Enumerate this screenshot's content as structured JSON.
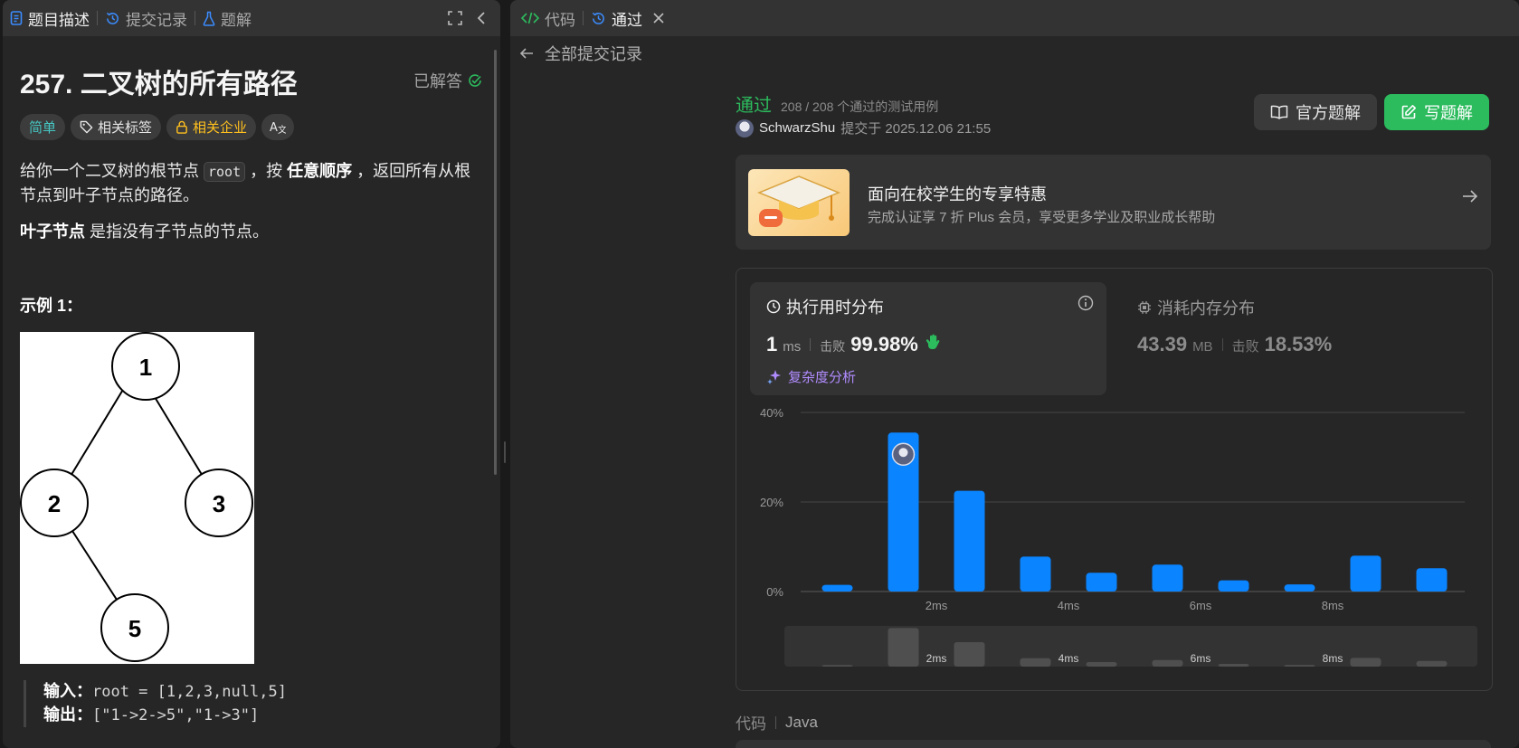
{
  "left_tabs": [
    {
      "label": "题目描述",
      "icon": "document-icon"
    },
    {
      "label": "提交记录",
      "icon": "history-icon"
    },
    {
      "label": "题解",
      "icon": "flask-icon"
    }
  ],
  "problem": {
    "title": "257. 二叉树的所有路径",
    "solved_label": "已解答",
    "tags": {
      "difficulty": "简单",
      "related_tags": "相关标签",
      "related_companies": "相关企业"
    },
    "desc_p1_a": "给你一个二叉树的根节点 ",
    "desc_p1_code": "root",
    "desc_p1_b": " ，按 ",
    "desc_p1_bold": "任意顺序",
    "desc_p1_c": " ，返回所有从根节点到叶子节点的路径。",
    "desc_p2_bold": "叶子节点",
    "desc_p2_rest": " 是指没有子节点的节点。",
    "example_title": "示例 1：",
    "tree_nodes": [
      "1",
      "2",
      "3",
      "5"
    ],
    "input_label": "输入：",
    "input_value": "root = [1,2,3,null,5]",
    "output_label": "输出：",
    "output_value": "[\"1->2->5\",\"1->3\"]"
  },
  "right_tabs": [
    {
      "label": "代码",
      "icon": "code-icon"
    },
    {
      "label": "通过",
      "icon": "history-icon"
    }
  ],
  "back_label": "全部提交记录",
  "submission": {
    "status": "通过",
    "cases": "208 / 208 个通过的测试用例",
    "user": "SchwarzShu",
    "submitted_at": "提交于 2025.12.06 21:55",
    "official_button": "官方题解",
    "write_button": "写题解"
  },
  "promo": {
    "title": "面向在校学生的专享特惠",
    "subtitle": "完成认证享 7 折 Plus 会员，享受更多学业及职业成长帮助"
  },
  "runtime": {
    "title": "执行用时分布",
    "value": "1",
    "unit": "ms",
    "beat_label": "击败",
    "beat_pct": "99.98%",
    "complexity_label": "复杂度分析"
  },
  "memory": {
    "title": "消耗内存分布",
    "value": "43.39",
    "unit": "MB",
    "beat_label": "击败",
    "beat_pct": "18.53%"
  },
  "chart_data": {
    "type": "bar",
    "bar_color": "#0a84ff",
    "yticks": [
      "40%",
      "20%",
      "0%"
    ],
    "ylim": [
      0,
      40
    ],
    "values": [
      1.5,
      35.5,
      22.5,
      7.8,
      4.2,
      6.0,
      2.5,
      1.6,
      8.0,
      5.2
    ],
    "x_ticks": [
      {
        "label": "2ms",
        "index": 2
      },
      {
        "label": "4ms",
        "index": 4
      },
      {
        "label": "6ms",
        "index": 6
      },
      {
        "label": "8ms",
        "index": 8
      }
    ],
    "user_bar_index": 1
  },
  "code_section": {
    "label": "代码",
    "language": "Java"
  },
  "colors": {
    "accent_green": "#2cbb5d",
    "accent_blue": "#0a84ff",
    "easy": "#46c6c2",
    "company": "#ffc01e"
  }
}
